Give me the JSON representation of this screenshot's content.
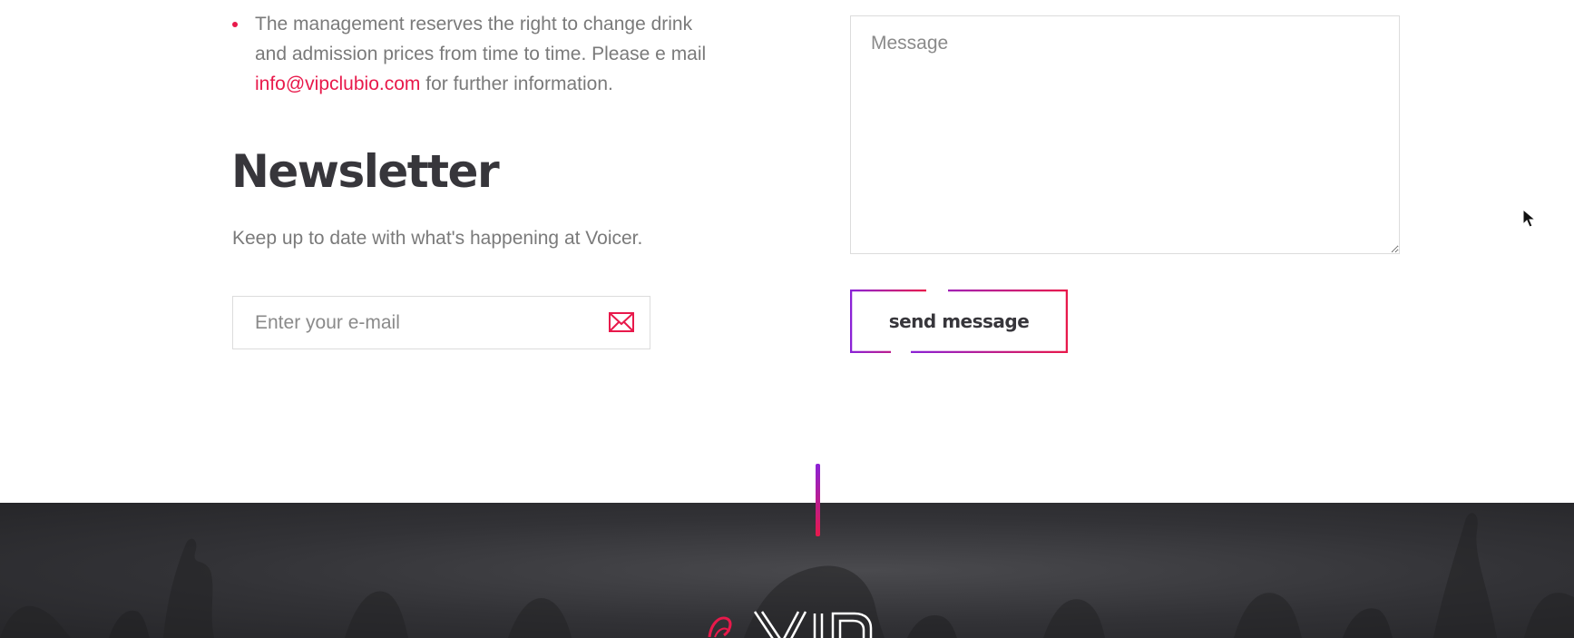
{
  "contact_info": {
    "bullet_text_before": "The management reserves the right to change drink and admission prices from time to time. Please e mail ",
    "email_link": "info@vipclubio.com",
    "bullet_text_after": " for further information."
  },
  "newsletter": {
    "title": "Newsletter",
    "subtitle": "Keep up to date with what's happening at Voicer.",
    "email_placeholder": "Enter your e-mail",
    "submit_icon": "envelope-icon"
  },
  "contact_form": {
    "message_placeholder": "Message",
    "send_label": "send message"
  },
  "footer": {
    "logo_alt": "VIP"
  },
  "colors": {
    "accent": "#e8194b",
    "accent_purple": "#8b22d6",
    "heading": "#37363b",
    "body_text": "#7a7a7a",
    "footer_bg": "#2e2e31"
  }
}
